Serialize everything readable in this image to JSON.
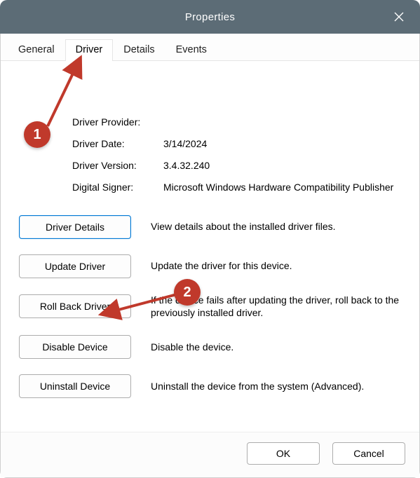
{
  "window": {
    "title": "Properties"
  },
  "tabs": [
    {
      "label": "General",
      "active": false
    },
    {
      "label": "Driver",
      "active": true
    },
    {
      "label": "Details",
      "active": false
    },
    {
      "label": "Events",
      "active": false
    }
  ],
  "driver_info": {
    "provider_label": "Driver Provider:",
    "provider_value": "",
    "date_label": "Driver Date:",
    "date_value": "3/14/2024",
    "version_label": "Driver Version:",
    "version_value": "3.4.32.240",
    "signer_label": "Digital Signer:",
    "signer_value": "Microsoft Windows Hardware Compatibility Publisher"
  },
  "actions": {
    "details": {
      "button": "Driver Details",
      "desc": "View details about the installed driver files."
    },
    "update": {
      "button": "Update Driver",
      "desc": "Update the driver for this device."
    },
    "rollback": {
      "button": "Roll Back Driver",
      "desc": "If the device fails after updating the driver, roll back to the previously installed driver."
    },
    "disable": {
      "button": "Disable Device",
      "desc": "Disable the device."
    },
    "uninstall": {
      "button": "Uninstall Device",
      "desc": "Uninstall the device from the system (Advanced)."
    }
  },
  "footer": {
    "ok": "OK",
    "cancel": "Cancel"
  },
  "annotations": {
    "badge1": "1",
    "badge2": "2"
  }
}
